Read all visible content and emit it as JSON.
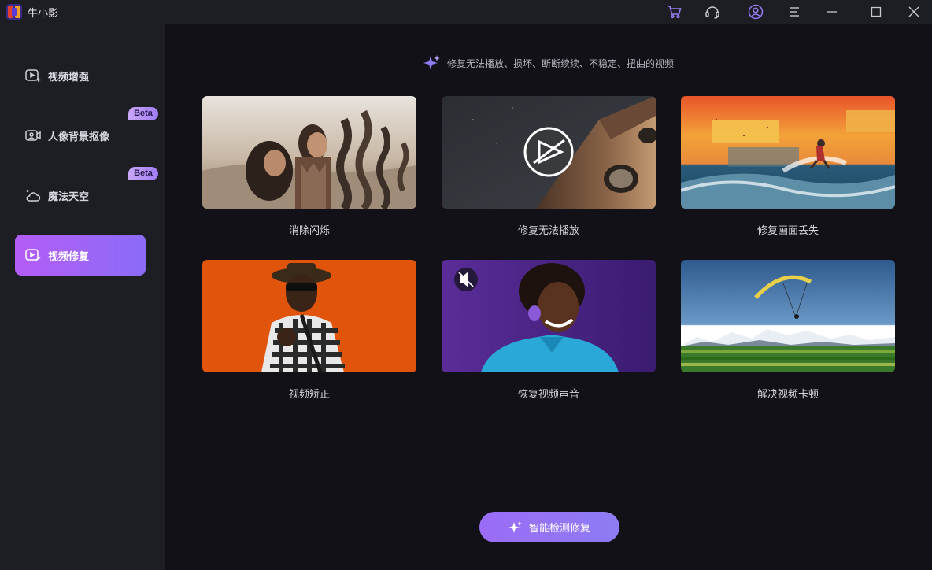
{
  "app": {
    "title": "牛小影"
  },
  "titlebar": {
    "icons": [
      "cart-icon",
      "headset-icon",
      "user-icon",
      "menu-icon",
      "minimize-icon",
      "maximize-icon",
      "close-icon"
    ]
  },
  "sidebar": {
    "items": [
      {
        "label": "视频增强",
        "icon": "video-enhance-icon",
        "active": false,
        "badge": ""
      },
      {
        "label": "人像背景抠像",
        "icon": "portrait-icon",
        "active": false,
        "badge": "Beta"
      },
      {
        "label": "魔法天空",
        "icon": "sky-icon",
        "active": false,
        "badge": "Beta"
      },
      {
        "label": "视频修复",
        "icon": "video-repair-icon",
        "active": true,
        "badge": ""
      }
    ]
  },
  "main": {
    "subtitle": "修复无法播放、损坏、断断续续、不稳定、扭曲的视频",
    "cards": [
      {
        "label": "消除闪烁"
      },
      {
        "label": "修复无法播放"
      },
      {
        "label": "修复画面丢失"
      },
      {
        "label": "视频矫正"
      },
      {
        "label": "恢复视频声音"
      },
      {
        "label": "解决视频卡顿"
      }
    ],
    "cta_label": "智能检测修复"
  },
  "colors": {
    "accent": "#8b6cf7",
    "accent_start": "#b45cf6",
    "sidebar_bg": "#1d1e24",
    "main_bg": "#111117"
  }
}
